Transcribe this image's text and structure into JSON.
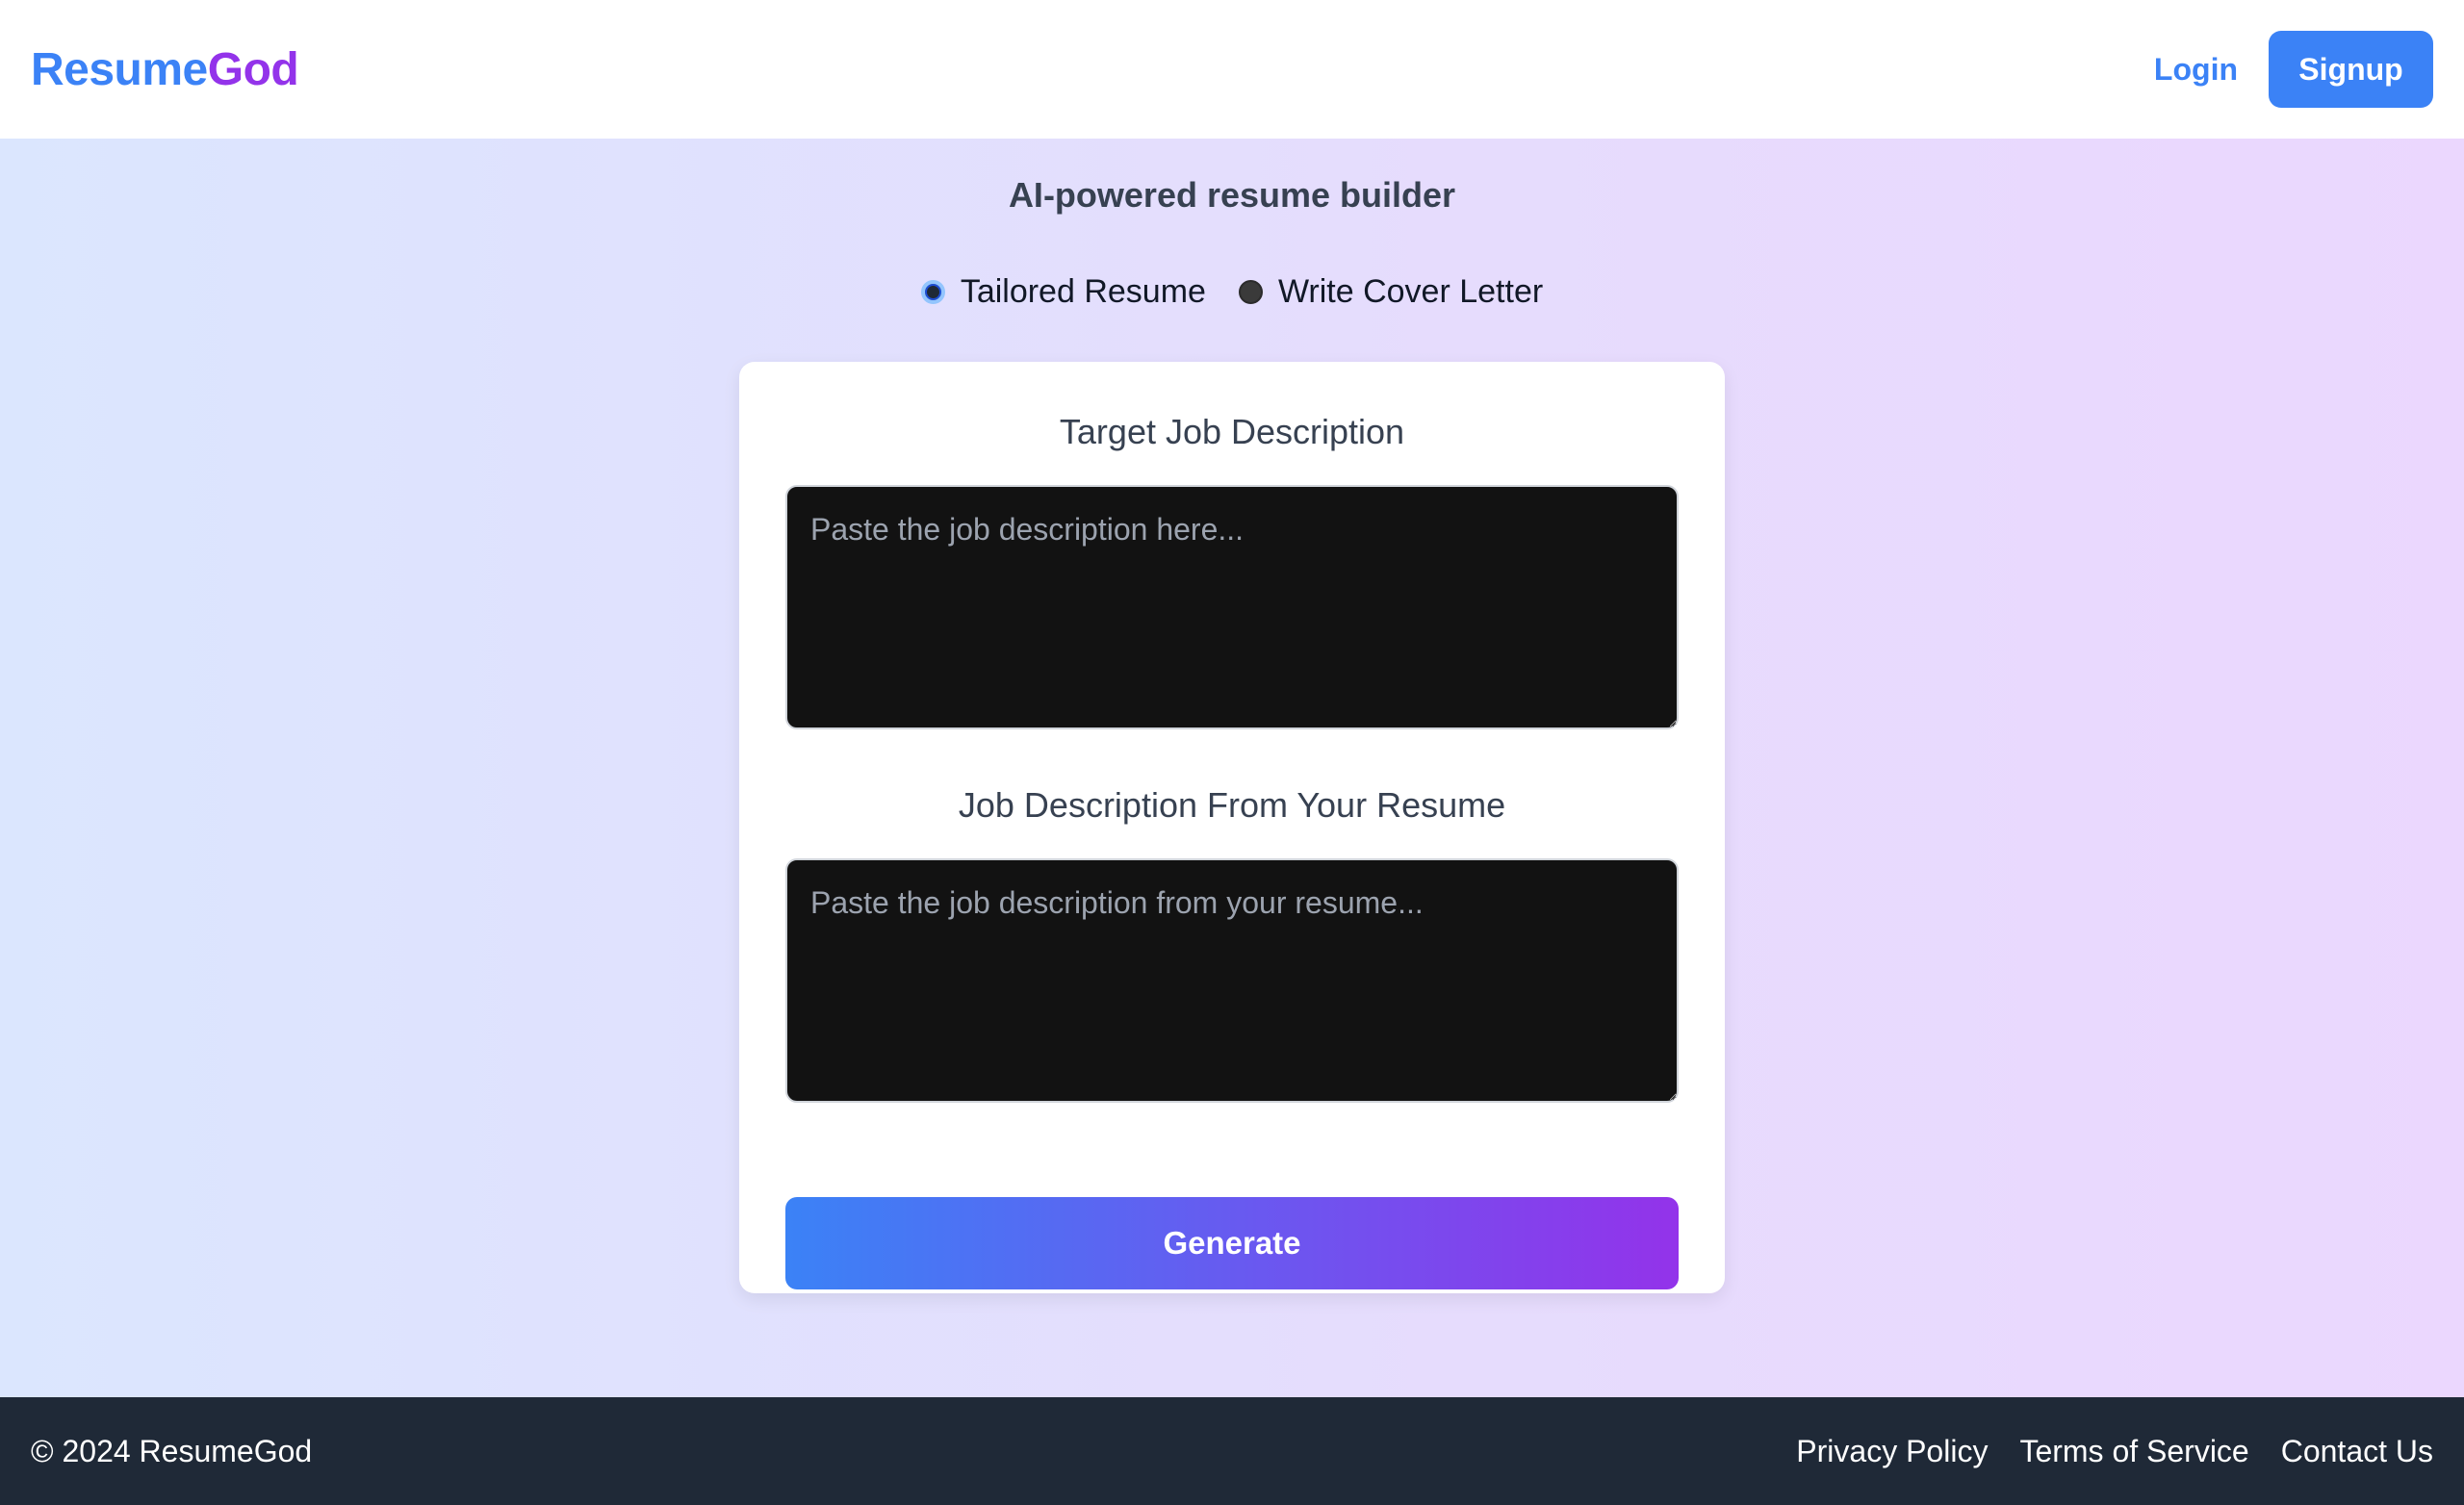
{
  "header": {
    "logo_part1": "Resume",
    "logo_part2": "God",
    "login_label": "Login",
    "signup_label": "Signup"
  },
  "main": {
    "subtitle": "AI-powered resume builder",
    "mode_options": [
      {
        "label": "Tailored Resume",
        "selected": true
      },
      {
        "label": "Write Cover Letter",
        "selected": false
      }
    ],
    "form": {
      "target_label": "Target Job Description",
      "target_placeholder": "Paste the job description here...",
      "target_value": "",
      "resume_label": "Job Description From Your Resume",
      "resume_placeholder": "Paste the job description from your resume...",
      "resume_value": "",
      "generate_label": "Generate"
    }
  },
  "footer": {
    "copyright": "© 2024 ResumeGod",
    "links": [
      "Privacy Policy",
      "Terms of Service",
      "Contact Us"
    ]
  },
  "colors": {
    "brand_blue": "#3b82f6",
    "brand_purple": "#9333ea",
    "footer_bg": "#1f2937",
    "textarea_bg": "#121212"
  }
}
